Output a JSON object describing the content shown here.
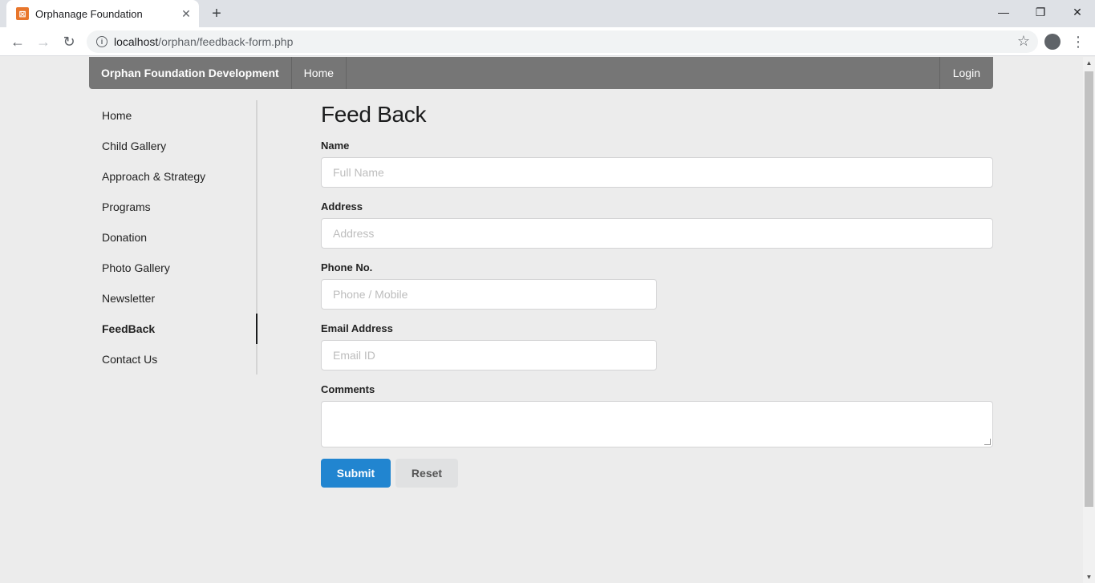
{
  "browser": {
    "tab_title": "Orphanage Foundation",
    "url_host": "localhost",
    "url_path": "/orphan/feedback-form.php"
  },
  "topnav": {
    "brand": "Orphan Foundation Development",
    "home": "Home",
    "login": "Login"
  },
  "sidebar": {
    "items": [
      {
        "label": "Home"
      },
      {
        "label": "Child Gallery"
      },
      {
        "label": "Approach & Strategy"
      },
      {
        "label": "Programs"
      },
      {
        "label": "Donation"
      },
      {
        "label": "Photo Gallery"
      },
      {
        "label": "Newsletter"
      },
      {
        "label": "FeedBack",
        "active": true
      },
      {
        "label": "Contact Us"
      }
    ]
  },
  "form": {
    "title": "Feed Back",
    "name_label": "Name",
    "name_placeholder": "Full Name",
    "address_label": "Address",
    "address_placeholder": "Address",
    "phone_label": "Phone No.",
    "phone_placeholder": "Phone / Mobile",
    "email_label": "Email Address",
    "email_placeholder": "Email ID",
    "comments_label": "Comments",
    "submit": "Submit",
    "reset": "Reset"
  },
  "colors": {
    "nav_bg": "#767676",
    "submit_bg": "#2185d0",
    "reset_bg": "#e0e1e2",
    "page_bg": "#ececec"
  }
}
